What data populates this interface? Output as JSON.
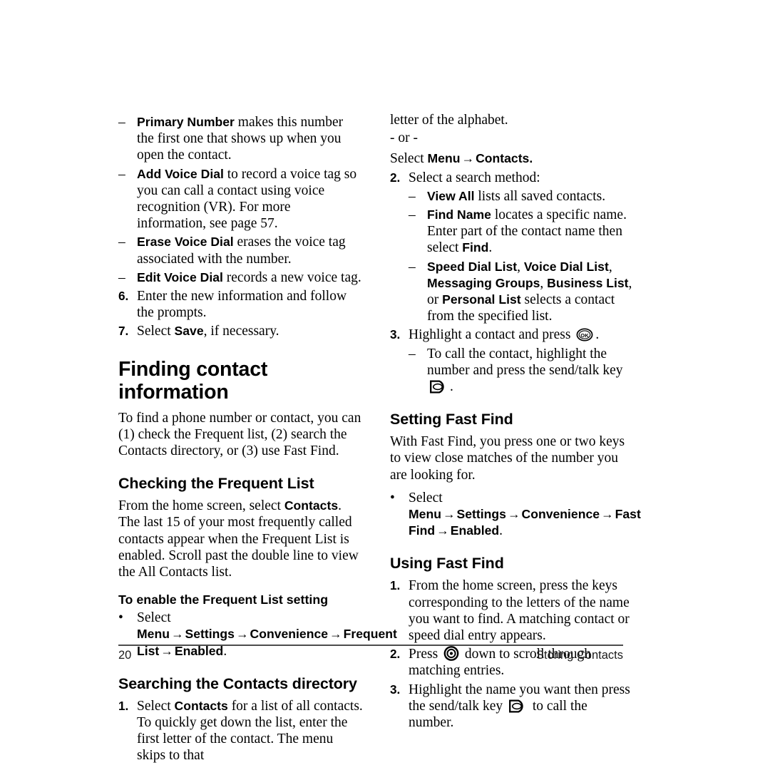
{
  "page": {
    "number": "20",
    "running_head": "Storing Contacts"
  },
  "icons": {
    "ok_key": "ok-key-icon",
    "send_talk_key": "send-talk-key-icon",
    "navigation_key": "navigation-key-icon"
  },
  "left_column": {
    "continued_list": [
      {
        "term": "Primary Number",
        "text": " makes this number the first one that shows up when you open the contact."
      },
      {
        "term": "Add Voice Dial",
        "text": " to record a voice tag so you can call a contact using voice recognition (VR). For more information, see page 57."
      },
      {
        "term": "Erase Voice Dial",
        "text": " erases the voice tag associated with the number."
      },
      {
        "term": "Edit Voice Dial",
        "text": " records a new voice tag."
      }
    ],
    "steps": [
      {
        "num": "6.",
        "text": "Enter the new information and follow the prompts."
      },
      {
        "num": "7.",
        "pre": "Select ",
        "term": "Save",
        "post": ", if necessary."
      }
    ],
    "heading_finding": "Finding contact information",
    "intro": "To find a phone number or contact, you can (1) check the Frequent list, (2) search the Contacts directory, or (3) use Fast Find.",
    "heading_frequent": "Checking the Frequent List",
    "frequent_para_pre": "From the home screen, select ",
    "frequent_para_term": "Contacts",
    "frequent_para_post": ". The last 15 of your most frequently called contacts appear when the Frequent List is enabled. Scroll past the double line to view the All Contacts list.",
    "heading_enable_frequent": "To enable the Frequent List setting",
    "enable_frequent_path": {
      "lead": "Select ",
      "steps": [
        "Menu",
        "Settings",
        "Convenience",
        "Frequent List",
        "Enabled"
      ],
      "arrow": "→",
      "period": "."
    },
    "heading_searching": "Searching the Contacts directory",
    "search_step_1": {
      "num": "1.",
      "pre": "Select ",
      "term": "Contacts",
      "post": " for a list of all contacts. To quickly get down the list, enter the first letter of the contact. The menu skips to that"
    }
  },
  "right_column": {
    "continued_line": "letter of the alphabet.",
    "or_divider": "- or -",
    "select_menu_contacts": {
      "lead": "Select ",
      "steps": [
        "Menu",
        "Contacts"
      ],
      "arrow": "→",
      "period": "."
    },
    "step_2": {
      "num": "2.",
      "text": "Select a search method:",
      "methods": [
        {
          "term": "View All",
          "text": " lists all saved contacts."
        },
        {
          "term": "Find Name",
          "text": " locates a specific name. Enter part of the contact name then select ",
          "term2": "Find",
          "post": "."
        },
        {
          "terms": [
            "Speed Dial List",
            "Voice Dial List",
            "Messaging Groups",
            "Business List",
            "Personal List"
          ],
          "sep1": ", ",
          "sep_or": ", or ",
          "post": " selects a contact from the specified list."
        }
      ]
    },
    "step_3": {
      "num": "3.",
      "pre": "Highlight a contact and press ",
      "post": ".",
      "sub": {
        "pre": "To call the contact, highlight the number and press the send/talk key ",
        "post": "."
      }
    },
    "heading_setting_fast_find": "Setting Fast Find",
    "fast_find_intro": "With Fast Find, you press one or two keys to view close matches of the number you are looking for.",
    "fast_find_path": {
      "lead": "Select ",
      "steps": [
        "Menu",
        "Settings",
        "Convenience",
        "Fast Find",
        "Enabled"
      ],
      "arrow": "→",
      "period": "."
    },
    "heading_using_fast_find": "Using Fast Find",
    "using_steps": [
      {
        "num": "1.",
        "text": "From the home screen, press the keys corresponding to the letters of the name you want to find. A matching contact or speed dial entry appears."
      },
      {
        "num": "2.",
        "pre": "Press ",
        "post": " down to scroll through matching entries."
      },
      {
        "num": "3.",
        "pre": "Highlight the name you want then press the send/talk key ",
        "post": " to call the number."
      }
    ]
  }
}
